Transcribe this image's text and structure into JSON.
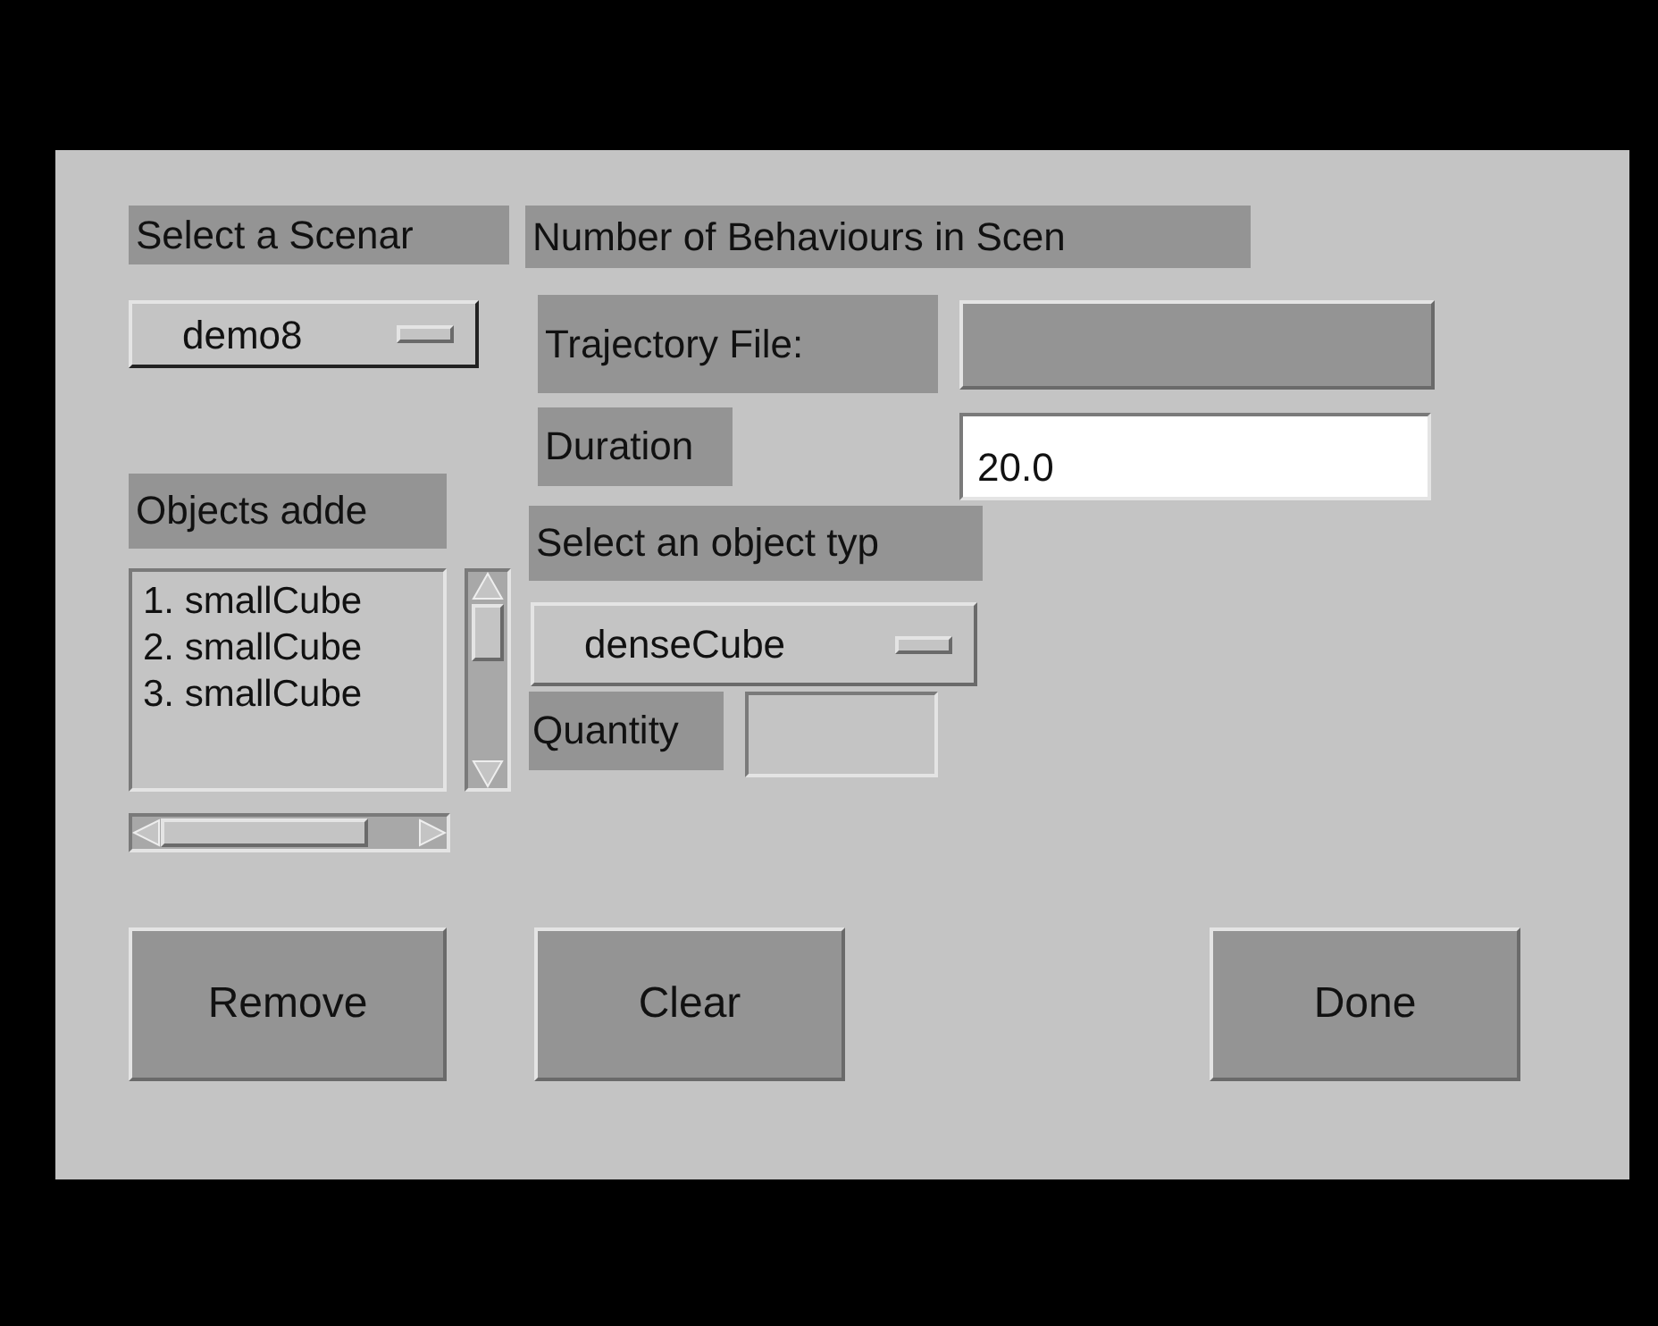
{
  "scenario": {
    "label": "Select a Scenar",
    "selected_option": "demo8"
  },
  "objects": {
    "label": "Objects adde",
    "items": [
      "1. smallCube",
      "2. smallCube",
      "3. smallCube"
    ]
  },
  "behaviours_label": "Number of Behaviours in Scen",
  "trajectory": {
    "label": "Trajectory File:"
  },
  "duration": {
    "label": "Duration",
    "value": "20.0"
  },
  "object_type": {
    "label": "Select an object typ",
    "selected_option": "denseCube"
  },
  "quantity": {
    "label": "Quantity"
  },
  "buttons": [
    "Remove",
    "Clear",
    "Done"
  ]
}
